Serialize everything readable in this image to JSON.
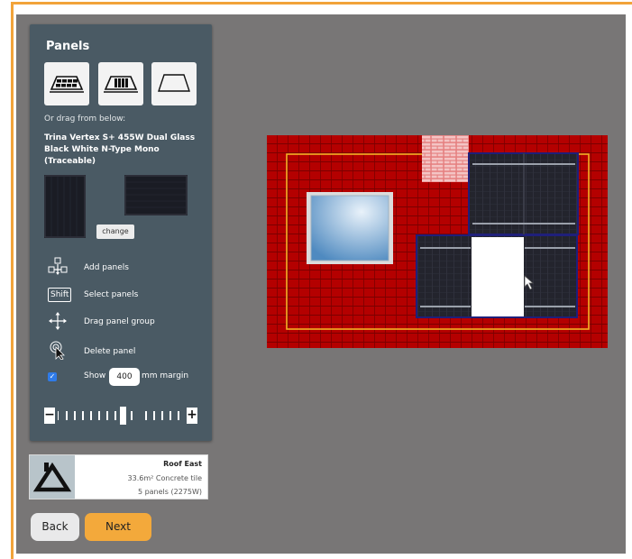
{
  "panel": {
    "title": "Panels",
    "drag_hint": "Or drag from below:",
    "product_name": "Trina Vertex S+ 455W Dual Glass Black White N-Type Mono (Traceable)",
    "change_label": "change",
    "help": {
      "add_panels": "Add panels",
      "shift_key": "Shift",
      "select_panels": "Select panels",
      "drag_group": "Drag panel group",
      "delete_panel": "Delete panel"
    },
    "show_label": "Show",
    "margin_value": "400",
    "margin_unit": "mm margin",
    "zoom_minus": "−",
    "zoom_plus": "+"
  },
  "roof_card": {
    "name": "Roof East",
    "area": "33.6m² Concrete tile",
    "panels": "5 panels (2275W)"
  },
  "buttons": {
    "back": "Back",
    "next": "Next"
  },
  "icons": {
    "layout_buttons": [
      "panel-row-layout-icon",
      "panel-grid-layout-icon",
      "empty-roof-layout-icon"
    ],
    "help_icons": [
      "add-panels-icon",
      "shift-key-icon",
      "move-icon",
      "delete-panel-icon"
    ],
    "roof_icon": "roof-icon"
  },
  "colors": {
    "accent": "#f3a93b",
    "panel_bg": "#4a5a64",
    "roof_tile": "#b40000",
    "selection": "#1f1f7a",
    "margin_line": "#f2b126"
  }
}
